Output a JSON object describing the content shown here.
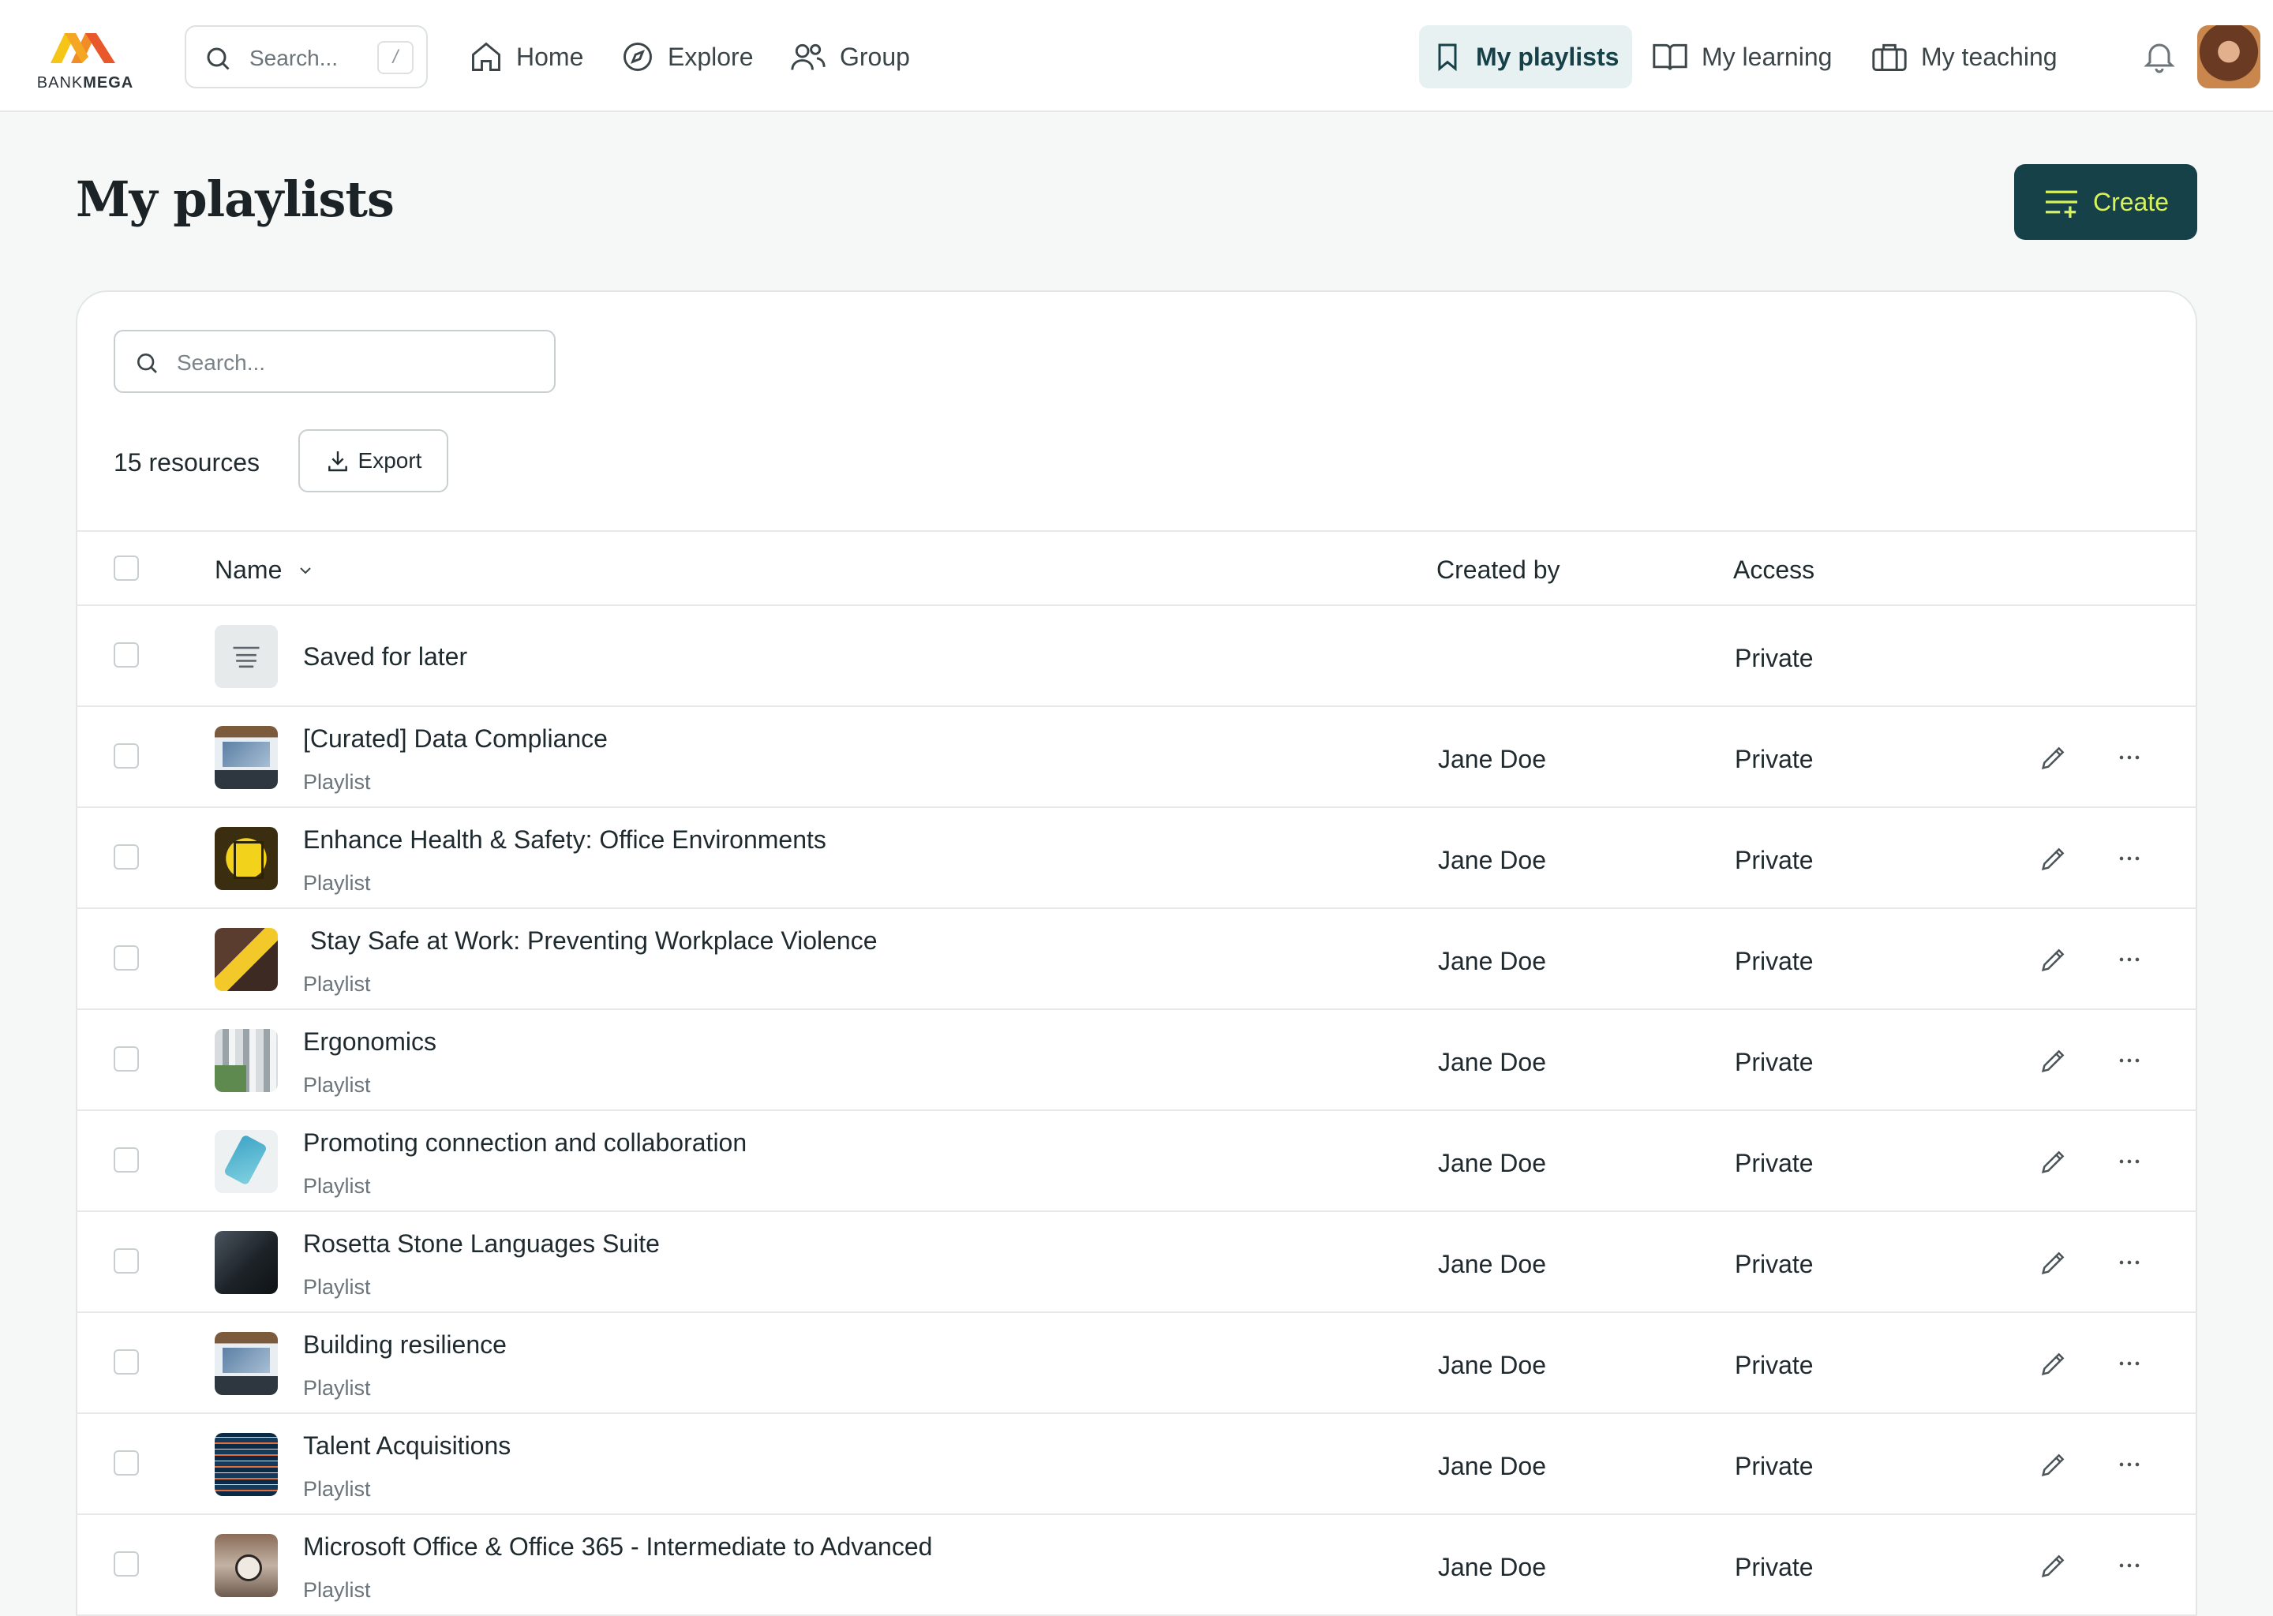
{
  "brand": {
    "logo_text_light": "BANK",
    "logo_text_bold": "MEGA"
  },
  "topbar": {
    "search_placeholder": "Search...",
    "search_shortcut": "/",
    "nav_left": [
      {
        "label": "Home",
        "icon": "home-icon"
      },
      {
        "label": "Explore",
        "icon": "compass-icon"
      },
      {
        "label": "Group",
        "icon": "users-icon"
      }
    ],
    "nav_right": [
      {
        "label": "My playlists",
        "icon": "bookmark-icon",
        "active": true
      },
      {
        "label": "My learning",
        "icon": "book-open-icon"
      },
      {
        "label": "My teaching",
        "icon": "briefcase-icon"
      }
    ],
    "notifications_icon": "bell-icon"
  },
  "page": {
    "title": "My playlists",
    "create_label": "Create"
  },
  "toolbar": {
    "search_placeholder": "Search...",
    "resource_count": "15 resources",
    "export_label": "Export"
  },
  "table": {
    "columns": {
      "name": "Name",
      "created_by": "Created by",
      "access": "Access"
    },
    "rows": [
      {
        "title": "Saved for later",
        "subtitle": "",
        "created_by": "",
        "access": "Private",
        "thumb": "saved",
        "actions": false
      },
      {
        "title": "[Curated] Data Compliance",
        "subtitle": "Playlist",
        "created_by": "Jane Doe",
        "access": "Private",
        "thumb": "laptop",
        "actions": true
      },
      {
        "title": "Enhance Health & Safety: Office Environments",
        "subtitle": "Playlist",
        "created_by": "Jane Doe",
        "access": "Private",
        "thumb": "yellow",
        "actions": true
      },
      {
        "title": " Stay Safe at Work: Preventing Workplace Violence",
        "subtitle": "Playlist",
        "created_by": "Jane Doe",
        "access": "Private",
        "thumb": "sign",
        "actions": true
      },
      {
        "title": "Ergonomics",
        "subtitle": "Playlist",
        "created_by": "Jane Doe",
        "access": "Private",
        "thumb": "ergo",
        "actions": true
      },
      {
        "title": "Promoting connection and collaboration",
        "subtitle": "Playlist",
        "created_by": "Jane Doe",
        "access": "Private",
        "thumb": "phone",
        "actions": true
      },
      {
        "title": "Rosetta Stone Languages Suite",
        "subtitle": "Playlist",
        "created_by": "Jane Doe",
        "access": "Private",
        "thumb": "dark",
        "actions": true
      },
      {
        "title": "Building resilience",
        "subtitle": "Playlist",
        "created_by": "Jane Doe",
        "access": "Private",
        "thumb": "laptop",
        "actions": true
      },
      {
        "title": "Talent Acquisitions",
        "subtitle": "Playlist",
        "created_by": "Jane Doe",
        "access": "Private",
        "thumb": "city",
        "actions": true
      },
      {
        "title": "Microsoft Office & Office 365 - Intermediate to Advanced",
        "subtitle": "Playlist",
        "created_by": "Jane Doe",
        "access": "Private",
        "thumb": "clock",
        "actions": true
      }
    ]
  },
  "colors": {
    "accent": "#174148",
    "accent_text": "#d7f25a",
    "logo_orange": "#f28c28",
    "logo_yellow": "#f5c518"
  }
}
